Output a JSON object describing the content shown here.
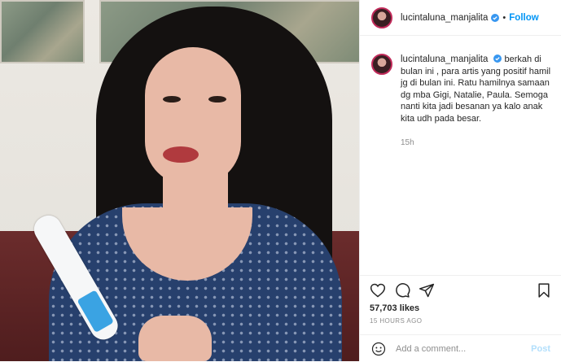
{
  "account": {
    "username": "lucintaluna_manjalita",
    "verified": true,
    "follow_label": "Follow",
    "separator": "•"
  },
  "caption": {
    "username": "lucintaluna_manjalita",
    "text": "berkah di bulan ini , para artis yang positif hamil jg di bulan ini. Ratu hamilnya samaan dg mba Gigi, Natalie, Paula. Semoga nanti kita jadi besanan ya kalo anak kita udh pada besar.",
    "time_ago": "15h"
  },
  "engagement": {
    "likes": "57,703 likes",
    "posted": "15 HOURS AGO"
  },
  "comment": {
    "placeholder": "Add a comment...",
    "post_label": "Post"
  },
  "icons": {
    "like": "heart-icon",
    "comment": "comment-icon",
    "share": "share-icon",
    "save": "bookmark-icon",
    "emoji": "emoji-icon",
    "verified": "verified-badge-icon"
  },
  "colors": {
    "accent": "#0095f6",
    "verified": "#3897f0",
    "muted": "#8e8e8e",
    "post_disabled": "#b2dffc"
  }
}
